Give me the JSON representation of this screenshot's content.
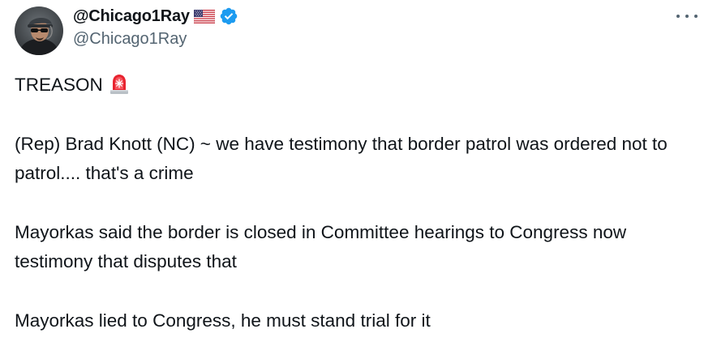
{
  "author": {
    "display_name": "@Chicago1Ray",
    "handle": "@Chicago1Ray",
    "flag_icon": "us-flag-icon",
    "verified_icon": "verified-badge-icon",
    "verified_color": "#1d9bf0"
  },
  "more_icon": "more-horizontal-icon",
  "tweet": {
    "line1": "TREASON",
    "line1_icon": "police-siren-icon",
    "para1": "(Rep) Brad Knott (NC) ~ we have testimony that border patrol was ordered not to patrol.... that's a crime",
    "para2": "Mayorkas said the border is closed in Committee hearings to Congress now testimony that disputes that",
    "para3": "Mayorkas lied to Congress, he must stand trial for it"
  },
  "colors": {
    "text": "#0f1419",
    "secondary": "#536471",
    "siren_red": "#e8232f"
  }
}
